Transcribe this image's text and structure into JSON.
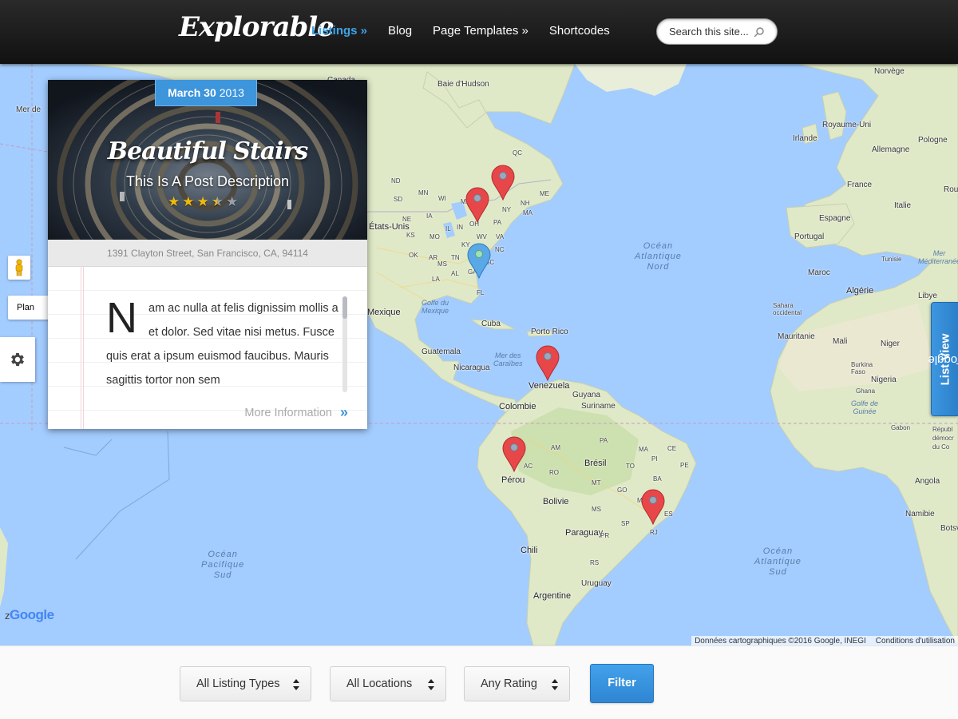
{
  "header": {
    "logo": "Explorable",
    "nav": [
      {
        "label": "Listings »"
      },
      {
        "label": "Blog"
      },
      {
        "label": "Page Templates »"
      },
      {
        "label": "Shortcodes"
      }
    ],
    "search_placeholder": "Search this site..."
  },
  "map": {
    "controls": {
      "plan_label": "Plan"
    },
    "toggle": {
      "prefix": "Toggle",
      "bold": "List View"
    },
    "google": "Google",
    "google_prefix": "z",
    "attribution": {
      "data": "Données cartographiques ©2016 Google, INEGI",
      "terms": "Conditions d'utilisation"
    },
    "labels": {
      "baie": "Baie d'Hudson",
      "etats": "États-Unis",
      "mexique": "Mexique",
      "golfe": "Golfe du\nMexique",
      "cuba": "Cuba",
      "porto": "Porto Rico",
      "guatemala": "Guatemala",
      "nicaragua": "Nicaragua",
      "merdes": "Mer des\nCaraïbes",
      "venezuela": "Venezuela",
      "guyana": "Guyana",
      "suriname": "Suriname",
      "colombie": "Colombie",
      "perou": "Pérou",
      "bresil": "Brésil",
      "bolivie": "Bolivie",
      "paraguay": "Paraguay",
      "chili": "Chili",
      "uruguay": "Uruguay",
      "argentine": "Argentine",
      "atl_nord": "Océan\nAtlantique\nNord",
      "atl_sud": "Océan\nAtlantique\nSud",
      "pacifique": "Océan\nPacifique\nSud",
      "mer_left": "Mer de",
      "norvege": "Norvège",
      "royaume": "Royaume-Uni",
      "irlande": "Irlande",
      "allemagne": "Allemagne",
      "pologne": "Pologne",
      "france": "France",
      "rou": "Rou",
      "espagne": "Espagne",
      "italie": "Italie",
      "portugal": "Portugal",
      "tunisie": "Tunisie",
      "mermed": "Mer\nMéditerranée",
      "maroc": "Maroc",
      "algerie": "Algérie",
      "libye": "Libye",
      "sahara": "Sahara\noccidental",
      "mauritanie": "Mauritanie",
      "mali": "Mali",
      "niger": "Niger",
      "burkina": "Burkina\nFaso",
      "ghana": "Ghana",
      "nigeria": "Nigeria",
      "golfeguinee": "Golfe de\nGuinée",
      "gabon": "Gabon",
      "rdc": "Républ\ndémocr\ndu Co",
      "angola": "Angola",
      "namibie": "Namibie",
      "botsw": "Botsv",
      "canada_partial": "Canada",
      "qc": "QC",
      "me": "ME",
      "nh": "NH",
      "ny": "NY",
      "pa": "PA",
      "oh": "OH",
      "wv": "WV",
      "va": "VA",
      "nc": "NC",
      "sc": "SC",
      "ga": "GA",
      "fl": "FL",
      "al": "AL",
      "ms": "MS",
      "tn": "TN",
      "ky": "KY",
      "in": "IN",
      "il": "IL",
      "mo": "MO",
      "ar": "AR",
      "la": "LA",
      "ok": "OK",
      "ks": "KS",
      "ne": "NE",
      "ia": "IA",
      "wi": "WI",
      "mi": "MI",
      "mn": "MN",
      "sd": "SD",
      "nd": "ND",
      "ma": "MA",
      "am": "AM",
      "pa_br": "PA",
      "ma_br": "MA",
      "ce": "CE",
      "pi": "PI",
      "ac": "AC",
      "ro": "RO",
      "to": "TO",
      "ba": "BA",
      "mt": "MT",
      "go": "GO",
      "mg": "MG",
      "ms_br": "MS",
      "sp": "SP",
      "pr": "PR",
      "rj": "RJ",
      "es": "ES",
      "rs": "RS",
      "pe": "PE"
    }
  },
  "card": {
    "date_bold": "March 30",
    "date_year": "2013",
    "title": "Beautiful Stairs",
    "description": "This Is A Post Description",
    "rating": 3.5,
    "address": "1391 Clayton Street, San Francisco, CA, 94114",
    "dropcap": "N",
    "excerpt": "am ac nulla at felis dignissim mollis a et dolor. Sed vitae nisi metus. Fusce quis erat a ipsum euismod faucibus. Mauris sagittis tortor non sem",
    "more_label": "More Information",
    "more_chevron": "»"
  },
  "filters": {
    "listing_types": "All Listing Types",
    "locations": "All Locations",
    "rating": "Any Rating",
    "button": "Filter"
  },
  "colors": {
    "accent": "#3d95dc",
    "pin_red": "#e8474a",
    "pin_blue": "#5aa9e6",
    "water": "#a3ccff",
    "land": "#dfe9c7"
  }
}
